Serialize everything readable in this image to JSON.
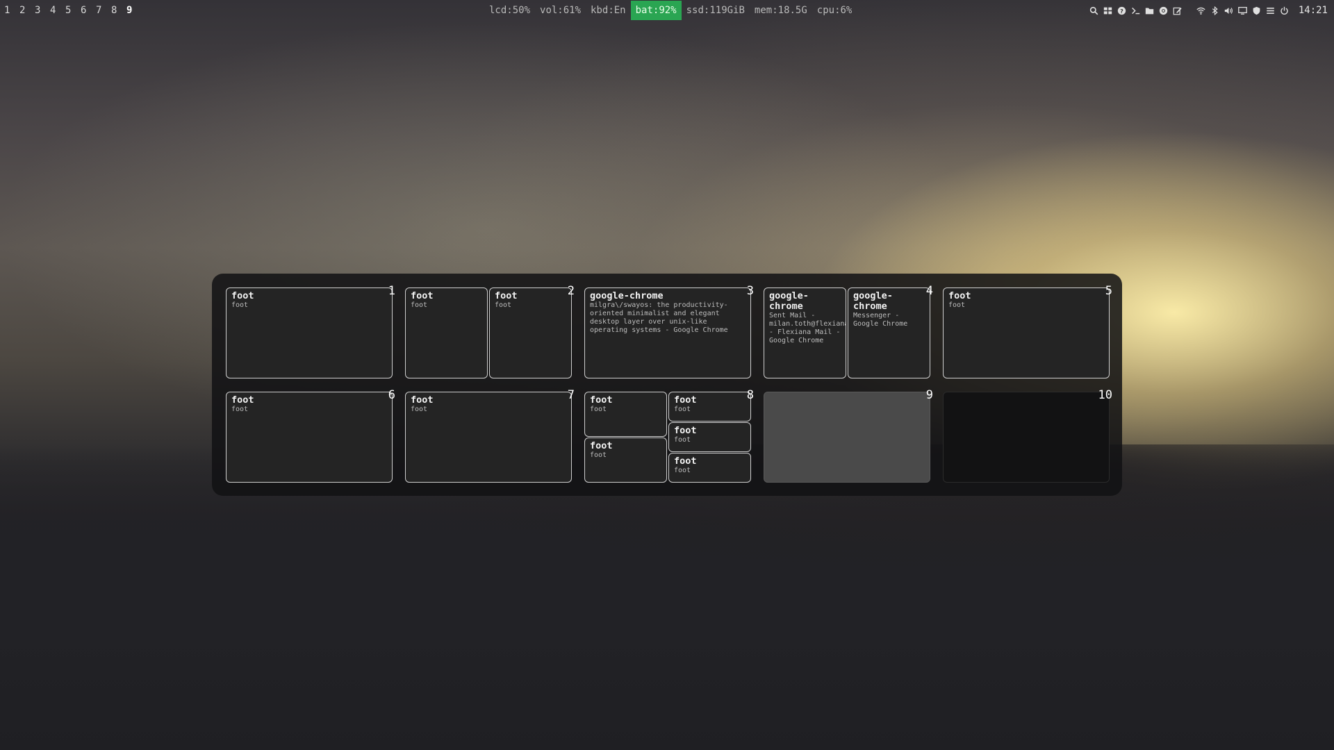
{
  "topbar": {
    "workspaces": [
      "1",
      "2",
      "3",
      "4",
      "5",
      "6",
      "7",
      "8",
      "9"
    ],
    "active_workspace": "9",
    "status": {
      "lcd": "lcd:50%",
      "vol": "vol:61%",
      "kbd": "kbd:En",
      "bat": "bat:92%",
      "ssd": "ssd:119GiB",
      "mem": "mem:18.5G",
      "cpu": "cpu:6%"
    },
    "battery_color": "#2aa552",
    "launcher_icons": [
      "search-icon",
      "grid-icon",
      "help-icon",
      "terminal-icon",
      "folder-icon",
      "chrome-icon",
      "edit-icon"
    ],
    "tray_icons": [
      "wifi-icon",
      "bluetooth-icon",
      "volume-icon",
      "display-icon",
      "shield-icon",
      "menu-icon",
      "power-icon"
    ],
    "clock": "14:21"
  },
  "overview": {
    "workspaces": [
      {
        "number": "1",
        "windows": [
          {
            "app": "foot",
            "title": "foot"
          }
        ]
      },
      {
        "number": "2",
        "windows": [
          {
            "app": "foot",
            "title": "foot"
          },
          {
            "app": "foot",
            "title": "foot"
          }
        ]
      },
      {
        "number": "3",
        "windows": [
          {
            "app": "google-chrome",
            "title": "milgra\\/swayos: the productivity-oriented minimalist and elegant desktop layer over unix-like operating systems - Google Chrome"
          }
        ]
      },
      {
        "number": "4",
        "windows": [
          {
            "app": "google-chrome",
            "title": "Sent Mail - milan.toth@flexiana.com - Flexiana Mail - Google Chrome"
          },
          {
            "app": "google-chrome",
            "title": "Messenger - Google Chrome"
          }
        ]
      },
      {
        "number": "5",
        "windows": [
          {
            "app": "foot",
            "title": "foot"
          }
        ]
      },
      {
        "number": "6",
        "windows": [
          {
            "app": "foot",
            "title": "foot"
          }
        ]
      },
      {
        "number": "7",
        "windows": [
          {
            "app": "foot",
            "title": "foot"
          }
        ]
      },
      {
        "number": "8",
        "windows": [
          {
            "app": "foot",
            "title": "foot"
          },
          {
            "app": "foot",
            "title": "foot"
          },
          {
            "app": "foot",
            "title": "foot"
          },
          {
            "app": "foot",
            "title": "foot"
          },
          {
            "app": "foot",
            "title": "foot"
          }
        ]
      },
      {
        "number": "9",
        "windows": []
      },
      {
        "number": "10",
        "windows": []
      }
    ]
  }
}
